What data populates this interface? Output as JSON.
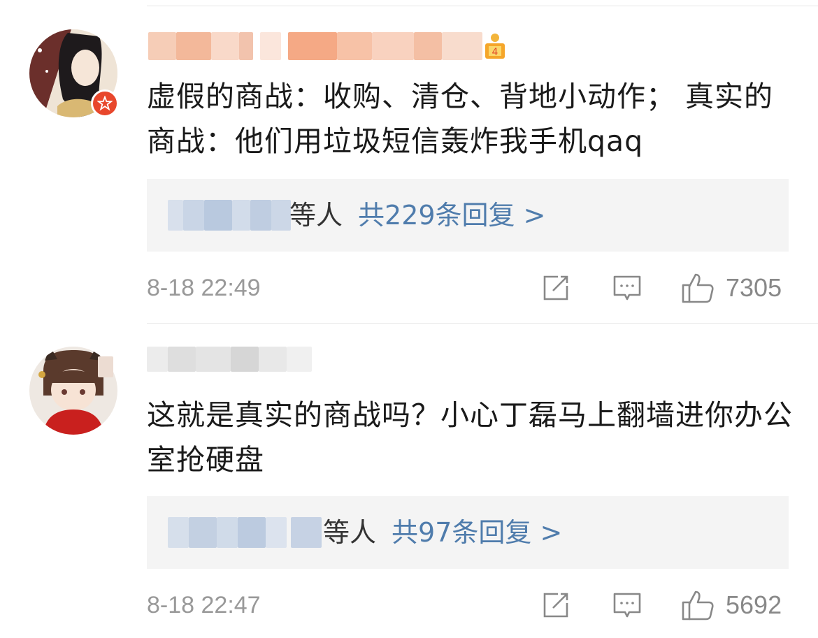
{
  "comments": [
    {
      "text": "虚假的商战：收购、清仓、背地小动作；  真实的商战：他们用垃圾短信轰炸我手机qaq",
      "reply_suffix": "等人",
      "reply_count": "共229条回复 >",
      "timestamp": "8-18 22:49",
      "likes": "7305",
      "level_badge": "4"
    },
    {
      "text": "这就是真实的商战吗？小心丁磊马上翻墙进你办公室抢硬盘",
      "reply_suffix": "等人",
      "reply_count": "共97条回复 >",
      "timestamp": "8-18 22:47",
      "likes": "5692"
    }
  ],
  "icons": {
    "repost": "repost-icon",
    "comment": "comment-icon",
    "like": "thumbs-up-icon",
    "verified": "verified-star-icon",
    "level": "level-trophy-icon"
  },
  "colors": {
    "reply_link": "#4f7cac",
    "meta_text": "#999999",
    "reply_bg": "#f4f4f4",
    "badge": "#e8472c"
  }
}
